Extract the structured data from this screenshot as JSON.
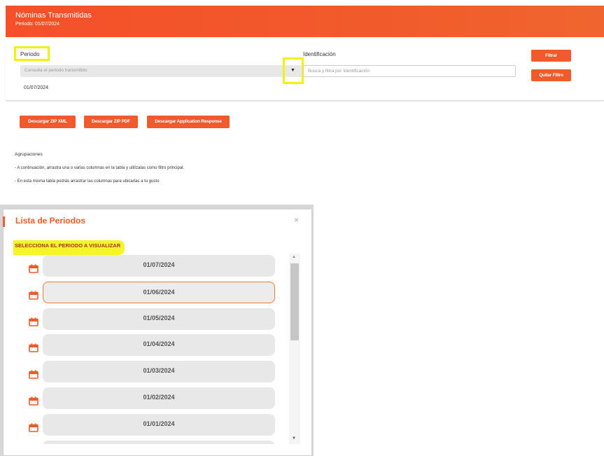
{
  "header": {
    "title": "Nóminas Transmitidas",
    "subtitle": "Periodo: 01/07/2024"
  },
  "filters": {
    "periodo_label": "Periodo",
    "periodo_placeholder": "Consulta el periodo transmitido",
    "periodo_value": "01/07/2024",
    "identificacion_label": "Identificación",
    "identificacion_placeholder": "Busca y filtra por Identificación",
    "filtrar_label": "Filtrar",
    "quitar_filtro_label": "Quitar Filtro"
  },
  "downloads": {
    "zip_xml": "Descargar ZIP XML",
    "zip_pdf": "Descargar ZIP PDF",
    "app_response": "Descargar Application Response"
  },
  "agrupaciones": {
    "title": "Agrupaciones",
    "line1": "- A continuación, arrastra una o varias columnas en la tabla y utilízalas como filtro principal.",
    "line2": "- En esta misma tabla podrás arrastrar las columnas para ubicarlas a tu gusto"
  },
  "modal": {
    "title": "Lista de Periodos",
    "close_icon": "×",
    "instruction": "SELECCIONA EL PERIODO A VISUALIZAR",
    "periods": [
      "01/07/2024",
      "01/06/2024",
      "01/05/2024",
      "01/04/2024",
      "01/03/2024",
      "01/02/2024",
      "01/01/2024",
      ""
    ],
    "selected_index": 1
  },
  "colors": {
    "brand": "#f15a2b",
    "highlight": "#f2f20a"
  }
}
